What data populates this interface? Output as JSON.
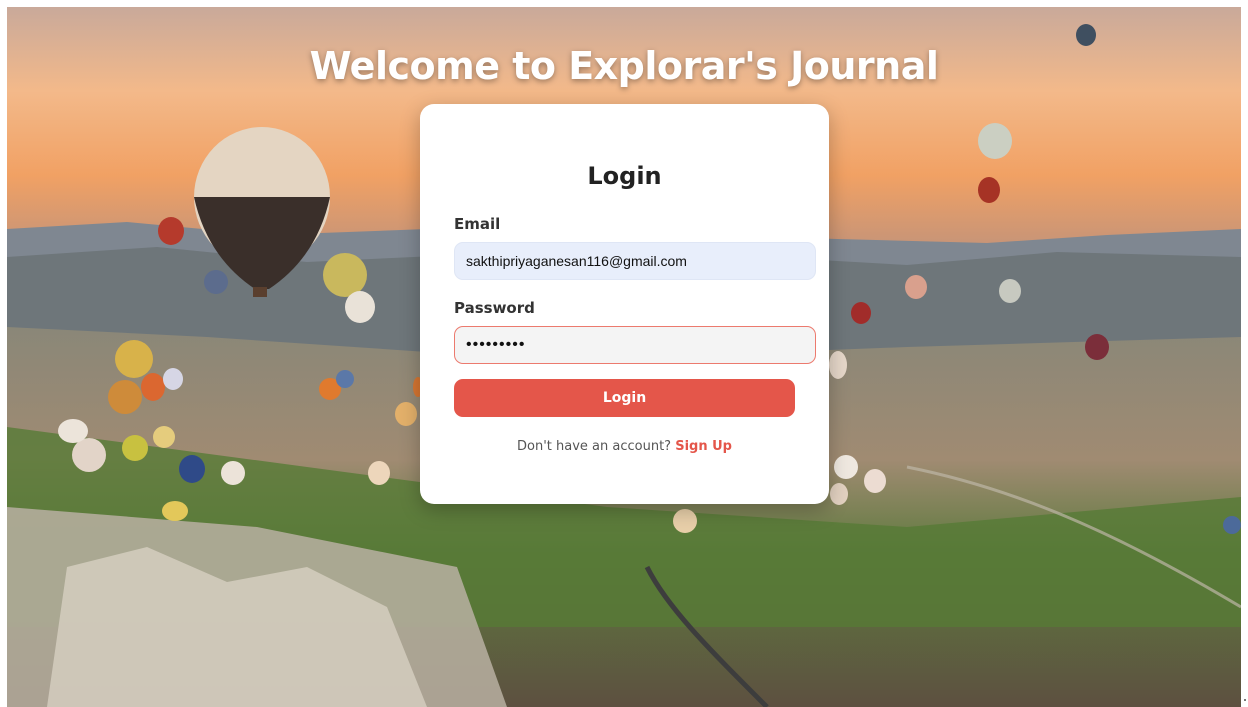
{
  "page": {
    "title": "Welcome to Explorar's Journal",
    "background_image": "hot-air-balloons-valley-photo"
  },
  "login_form": {
    "heading": "Login",
    "email_label": "Email",
    "email_value": "sakthipriyaganesan116@gmail.com",
    "password_label": "Password",
    "password_value": "•••••••••",
    "submit_label": "Login",
    "signup_prompt": "Don't have an account?",
    "signup_link": "Sign Up"
  },
  "colors": {
    "accent": "#e4564a",
    "email_field_bg": "#e8eefb",
    "password_border": "#ec7a6e",
    "card_bg": "#ffffff"
  }
}
